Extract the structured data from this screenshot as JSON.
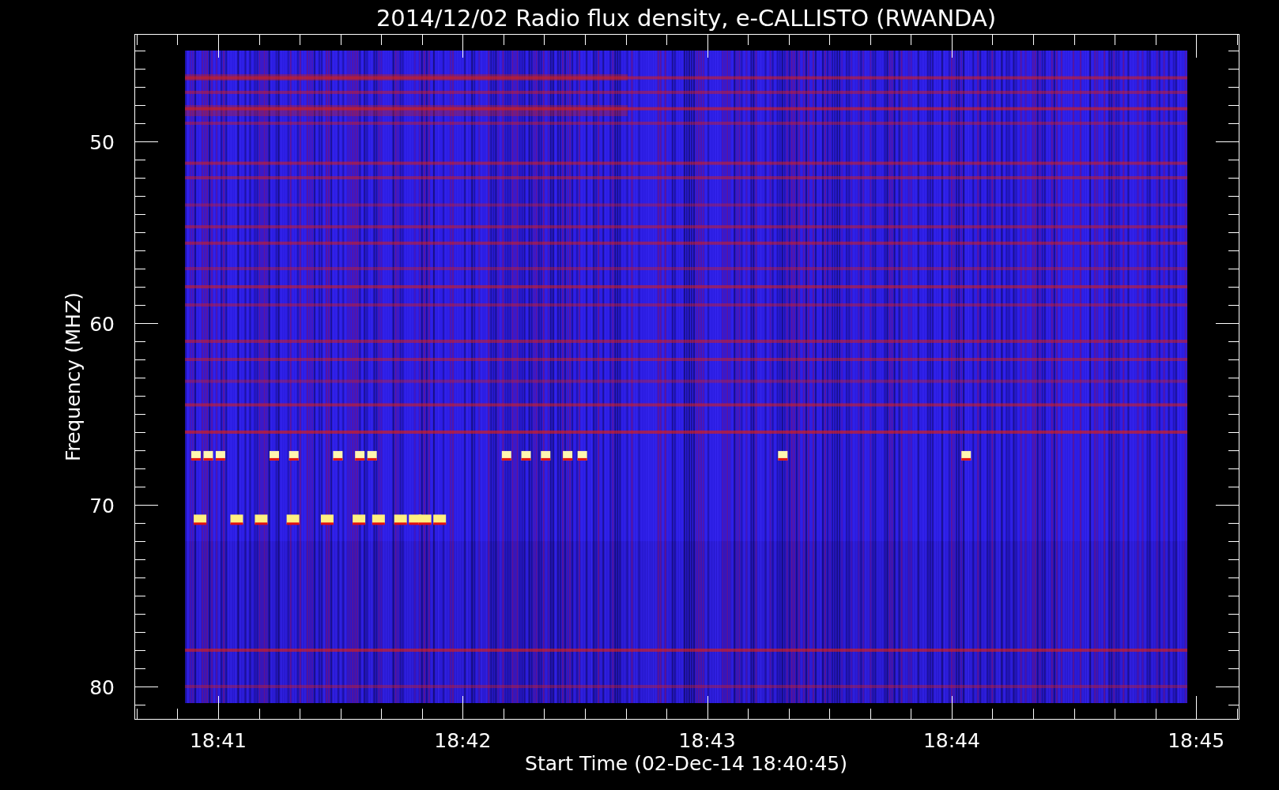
{
  "title": "2014/12/02  Radio flux density, e-CALLISTO (RWANDA)",
  "y_axis": {
    "label": "Frequency (MHZ)",
    "tick_labels": [
      "50",
      "60",
      "70",
      "80"
    ]
  },
  "x_axis": {
    "label": "Start Time (02-Dec-14 18:40:45)",
    "tick_labels": [
      "18:41",
      "18:42",
      "18:43",
      "18:44",
      "18:45"
    ]
  }
}
